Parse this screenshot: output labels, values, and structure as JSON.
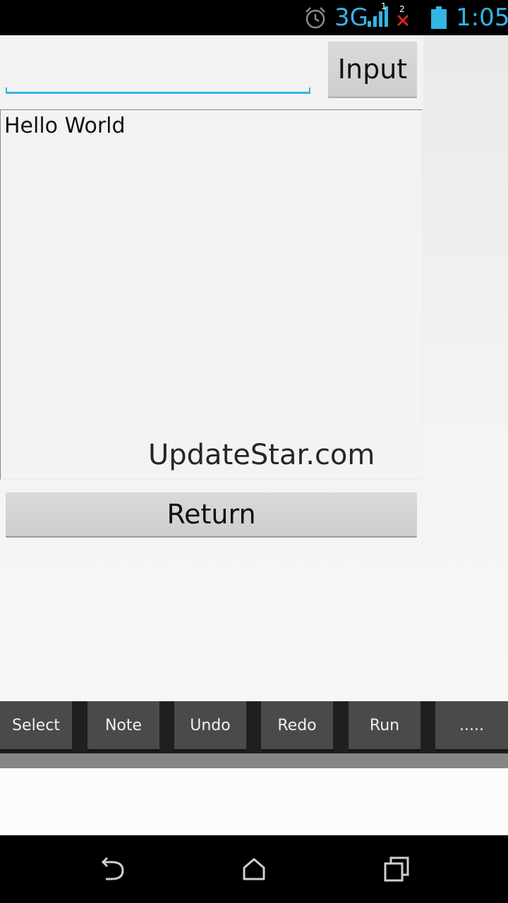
{
  "status_bar": {
    "network_type": "3G",
    "sim1_label": "1",
    "sim2_label": "2",
    "time": "1:05",
    "icons": [
      "alarm-icon",
      "signal-icon",
      "no-signal-x-icon",
      "battery-icon"
    ],
    "accent_color": "#33b5e5"
  },
  "form": {
    "input_value": "",
    "input_placeholder": "",
    "input_button_label": "Input"
  },
  "output": {
    "text": "Hello World",
    "watermark": "UpdateStar.com"
  },
  "return_button_label": "Return",
  "toolbar": {
    "items": [
      {
        "label": "Select"
      },
      {
        "label": "Note"
      },
      {
        "label": "Undo"
      },
      {
        "label": "Redo"
      },
      {
        "label": "Run"
      },
      {
        "label": "....."
      }
    ]
  },
  "nav_bar": {
    "icons": [
      "back-icon",
      "home-icon",
      "recents-icon"
    ]
  }
}
